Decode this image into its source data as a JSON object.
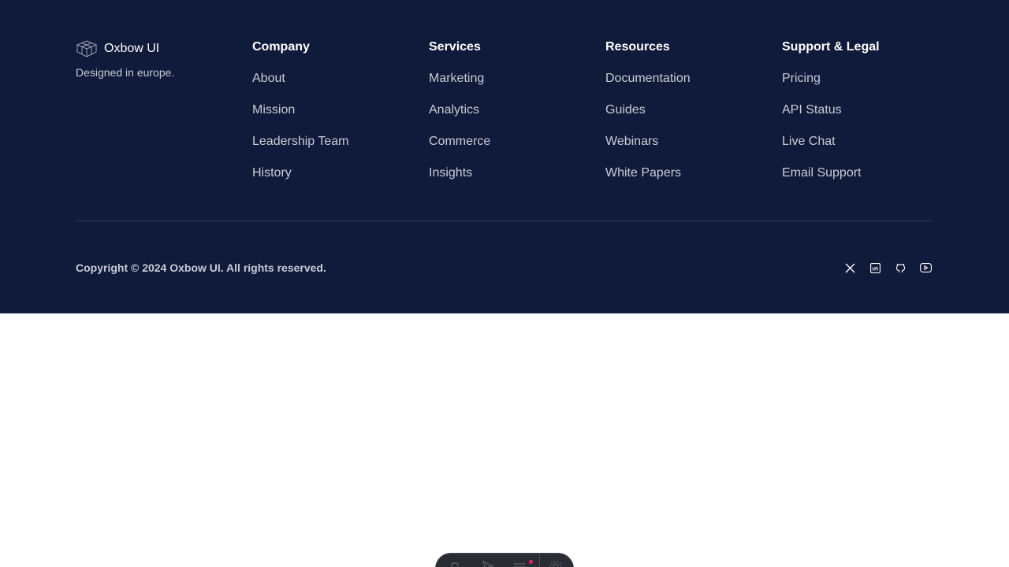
{
  "brand": {
    "name": "Oxbow UI",
    "tagline": "Designed in europe."
  },
  "columns": [
    {
      "heading": "Company",
      "links": [
        "About",
        "Mission",
        "Leadership Team",
        "History"
      ]
    },
    {
      "heading": "Services",
      "links": [
        "Marketing",
        "Analytics",
        "Commerce",
        "Insights"
      ]
    },
    {
      "heading": "Resources",
      "links": [
        "Documentation",
        "Guides",
        "Webinars",
        "White Papers"
      ]
    },
    {
      "heading": "Support & Legal",
      "links": [
        "Pricing",
        "API Status",
        "Live Chat",
        "Email Support"
      ]
    }
  ],
  "copyright": "Copyright © 2024 Oxbow UI. All rights reserved.",
  "socials": [
    "x-icon",
    "linkedin-icon",
    "github-icon",
    "youtube-icon"
  ],
  "colors": {
    "footer_bg": "#101a3a",
    "heading": "#ffffff",
    "link": "#c9ccd6",
    "divider": "#2f3a5c",
    "dock_bg": "#2b2c33",
    "dock_dot": "#e0245e"
  }
}
